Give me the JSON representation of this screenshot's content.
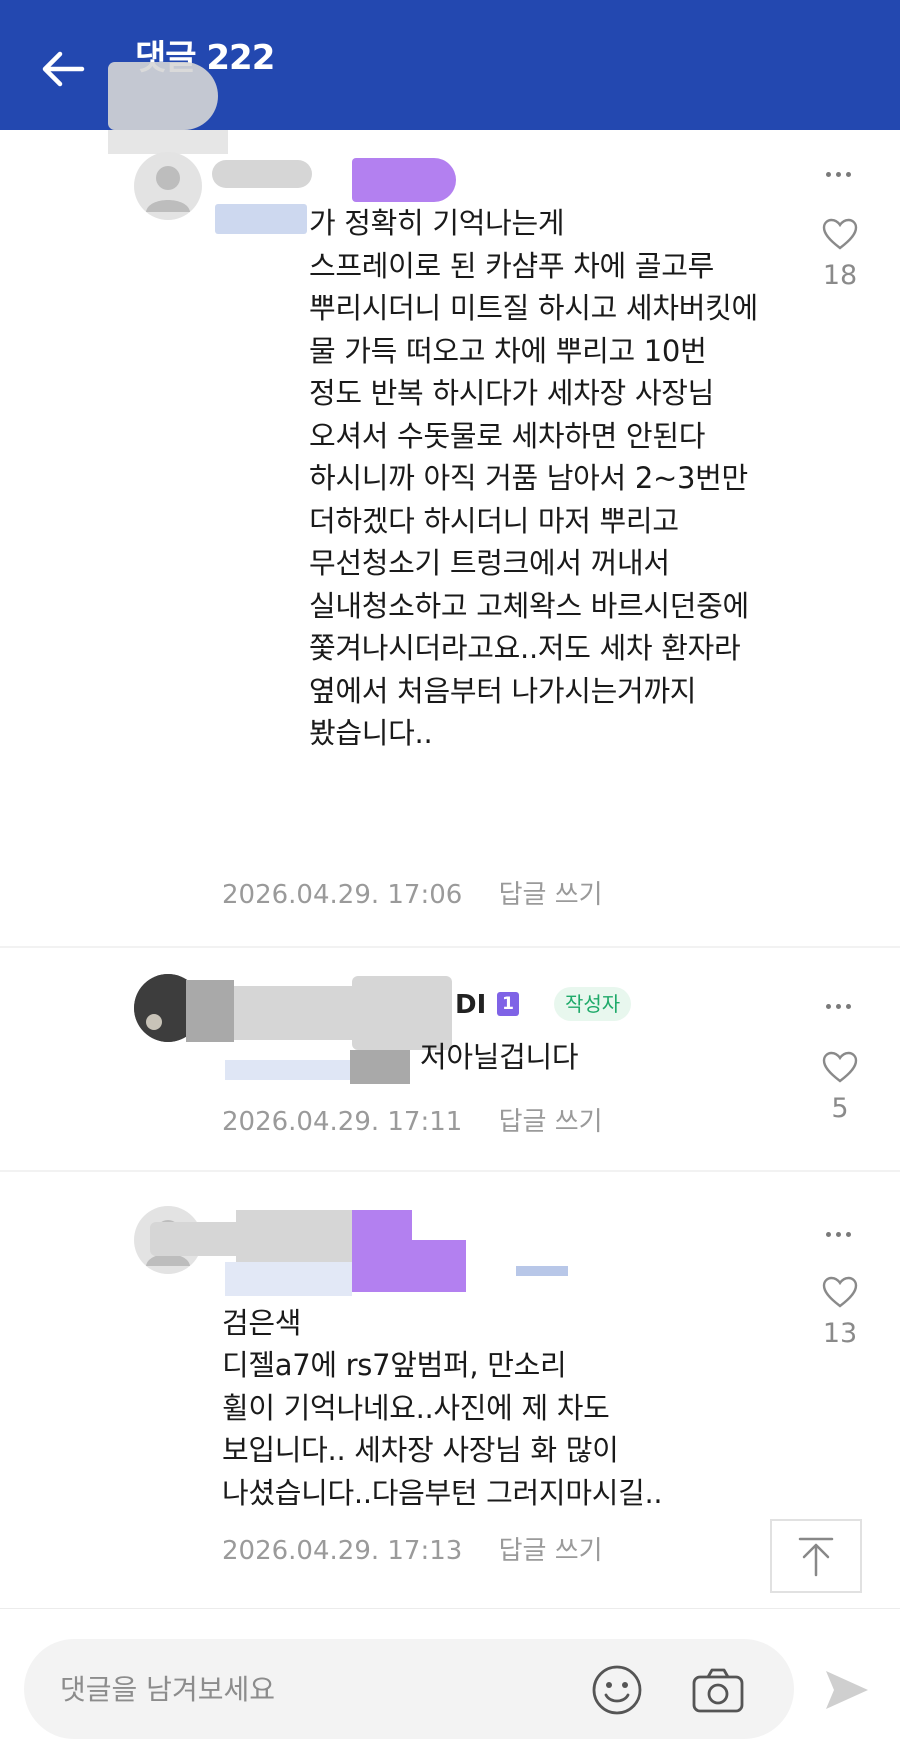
{
  "header": {
    "title": "댓글 222",
    "back_icon": "arrow-left-icon",
    "background": "#2348b0"
  },
  "comments": [
    {
      "author_visible": "",
      "text": "가 정확히 기억나는게\n스프레이로 된 카샴푸 차에 골고루\n뿌리시더니 미트질 하시고 세차버킷에\n물 가득 떠오고 차에 뿌리고 10번\n정도 반복 하시다가 세차장 사장님\n오셔서 수돗물로 세차하면 안된다\n하시니까 아직 거품 남아서 2~3번만\n더하겠다 하시더니 마저 뿌리고\n무선청소기 트렁크에서 꺼내서\n실내청소하고 고체왁스 바르시던중에\n쫓겨나시더라고요..저도 세차 환자라\n옆에서 처음부터 나가시는거까지\n봤습니다..",
      "date": "2026.04.29. 17:06",
      "reply_label": "답글 쓰기",
      "likes": "18"
    },
    {
      "author_visible": "DI",
      "level": "1",
      "author_badge": "작성자",
      "text": "저아닐겁니다",
      "date": "2026.04.29. 17:11",
      "reply_label": "답글 쓰기",
      "likes": "5"
    },
    {
      "author_visible": "",
      "text": "검은색\n디젤a7에 rs7앞범퍼, 만소리\n휠이 기억나네요..사진에 제 차도\n보입니다.. 세차장 사장님 화 많이\n나셨습니다..다음부턴 그러지마시길..",
      "date": "2026.04.29. 17:13",
      "reply_label": "답글 쓰기",
      "likes": "13"
    }
  ],
  "input": {
    "placeholder": "댓글을 남겨보세요",
    "value": ""
  },
  "icons": {
    "more": "more-dots-icon",
    "like": "heart-icon",
    "scroll_top": "scroll-to-top-icon",
    "emoji": "emoji-smile-icon",
    "camera": "camera-icon",
    "send": "send-icon"
  },
  "colors": {
    "header": "#2348b0",
    "author_badge_bg": "#e8f7ee",
    "author_badge_text": "#1faa6a",
    "level_badge": "#7f63e6",
    "meta_text": "#9a9a9a"
  }
}
